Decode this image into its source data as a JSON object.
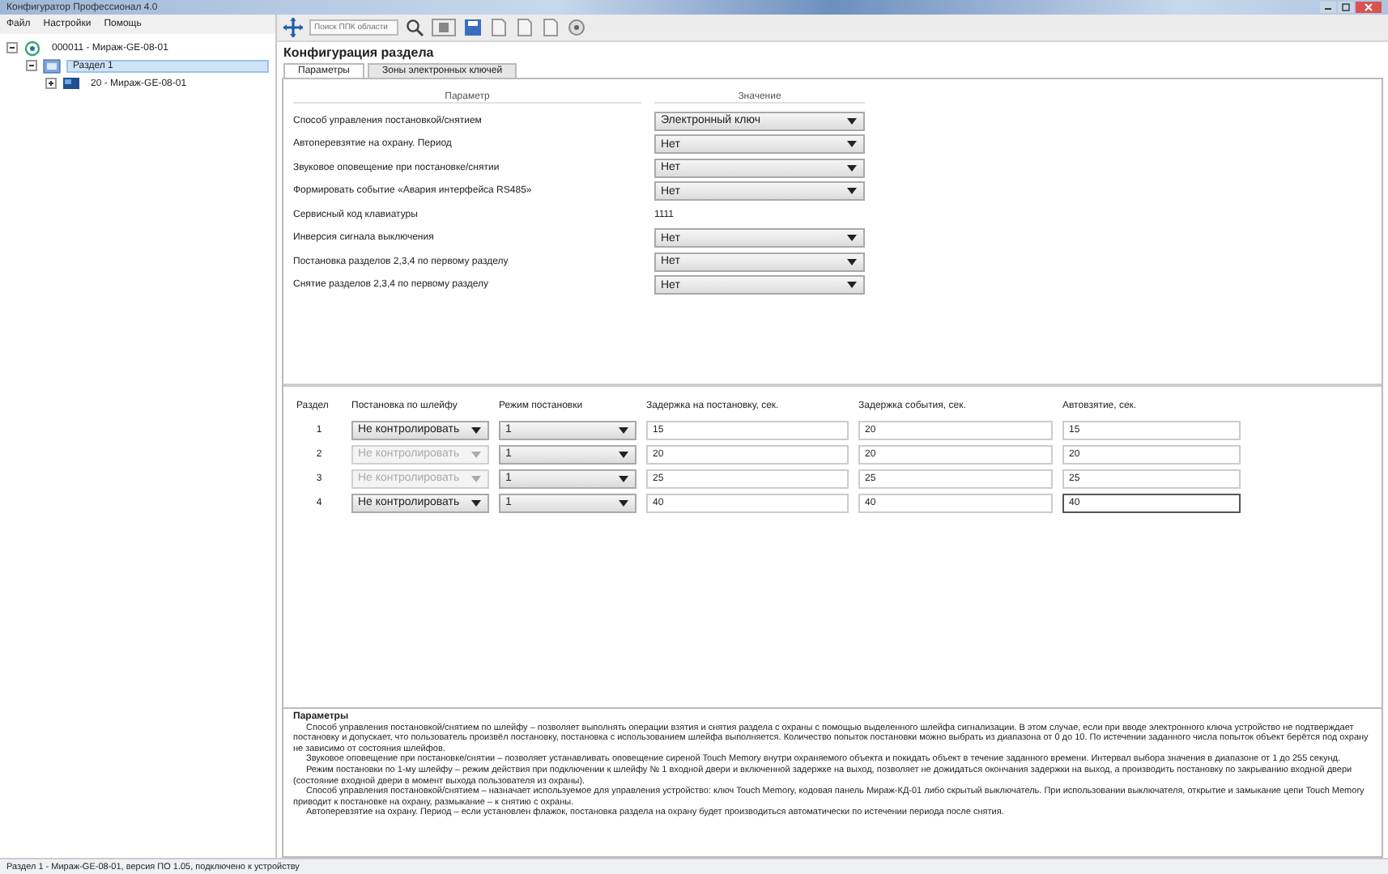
{
  "window": {
    "title": "Конфигуратор Профессионал 4.0"
  },
  "menu": [
    "Файл",
    "Настройки",
    "Помощь"
  ],
  "toolbar": {
    "search": {
      "placeholder": "Поиск ППК области"
    }
  },
  "tree": [
    {
      "label": "000011 - Мираж-GE-08-01",
      "expanded": true,
      "selected": false,
      "children": [
        {
          "label": "Раздел 1",
          "expanded": true,
          "selected": true,
          "children": [
            {
              "label": "20 - Мираж-GE-08-01",
              "expanded": false,
              "selected": false
            }
          ]
        }
      ]
    }
  ],
  "heading": "Конфигурация раздела",
  "tabs": [
    {
      "label": "Параметры",
      "selected": true
    },
    {
      "label": "Зоны электронных ключей",
      "selected": false
    }
  ],
  "params": {
    "columns": [
      "Параметр",
      "Значение"
    ],
    "rows": [
      {
        "name": "Способ управления постановкой/снятием",
        "kind": "select",
        "value": "Электронный ключ"
      },
      {
        "name": "Автоперевзятие на охрану. Период",
        "kind": "select",
        "value": "Нет"
      },
      {
        "name": "Звуковое оповещение при постановке/снятии",
        "kind": "select",
        "value": "Нет"
      },
      {
        "name": "Формировать событие «Авария интерфейса RS485»",
        "kind": "select",
        "value": "Нет"
      },
      {
        "name": "Сервисный код клавиатуры",
        "kind": "text",
        "value": "1111"
      },
      {
        "name": "Инверсия сигнала выключения",
        "kind": "select",
        "value": "Нет"
      },
      {
        "name": "Постановка разделов 2,3,4 по первому разделу",
        "kind": "select",
        "value": "Нет"
      },
      {
        "name": "Снятие разделов 2,3,4 по первому разделу",
        "kind": "select",
        "value": "Нет"
      }
    ]
  },
  "sections": {
    "columns": [
      "Раздел",
      "Постановка по шлейфу",
      "Режим постановки",
      "Задержка на постановку, сек.",
      "Задержка события, сек.",
      "Автовзятие, сек."
    ],
    "rows": [
      {
        "number": "1",
        "loop": "Не контролировать",
        "loop_disabled": false,
        "mode": "1",
        "arm_delay": "15",
        "event_delay": "20",
        "auto_arm": "15",
        "focused": false
      },
      {
        "number": "2",
        "loop": "Не контролировать",
        "loop_disabled": true,
        "mode": "1",
        "arm_delay": "20",
        "event_delay": "20",
        "auto_arm": "20",
        "focused": false
      },
      {
        "number": "3",
        "loop": "Не контролировать",
        "loop_disabled": true,
        "mode": "1",
        "arm_delay": "25",
        "event_delay": "25",
        "auto_arm": "25",
        "focused": false
      },
      {
        "number": "4",
        "loop": "Не контролировать",
        "loop_disabled": false,
        "mode": "1",
        "arm_delay": "40",
        "event_delay": "40",
        "auto_arm": "40",
        "focused": true
      }
    ]
  },
  "help": {
    "title": "Параметры",
    "paragraphs": [
      "Способ управления постановкой/снятием по шлейфу – позволяет выполнять операции взятия и снятия раздела с охраны с помощью выделенного шлейфа сигнализации. В этом случае, если при вводе электронного ключа устройство не подтверждает постановку и допускает, что пользователь произвёл постановку, постановка с использованием шлейфа выполняется. Количество попыток постановки можно выбрать из диапазона от 0 до 10. По истечении заданного числа попыток объект берётся под охрану не зависимо от состояния шлейфов.",
      "Звуковое оповещение при постановке/снятии – позволяет устанавливать оповещение сиреной Touch Memory внутри охраняемого объекта и покидать объект в течение заданного времени. Интервал выбора значения в диапазоне от 1 до 255 секунд.",
      "Режим постановки по 1-му шлейфу – режим действия при подключении к шлейфу № 1 входной двери и включенной задержке на выход, позволяет не дожидаться окончания задержки на выход, а производить постановку по закрыванию входной двери (состояние входной двери в момент выхода пользователя из охраны).",
      "Способ управления постановкой/снятием – назначает используемое для управления устройство: ключ Touch Memory, кодовая панель Мираж-КД-01 либо скрытый выключатель. При использовании выключателя, открытие и замыкание цепи Touch Memory приводит к постановке на охрану, размыкание – к снятию с охраны.",
      "Автоперевзятие на охрану. Период – если установлен флажок, постановка раздела на охрану будет производиться автоматически по истечении периода после снятия."
    ]
  },
  "status_bar": "Раздел 1 - Мираж-GE-08-01, версия ПО 1.05, подключено к устройству"
}
